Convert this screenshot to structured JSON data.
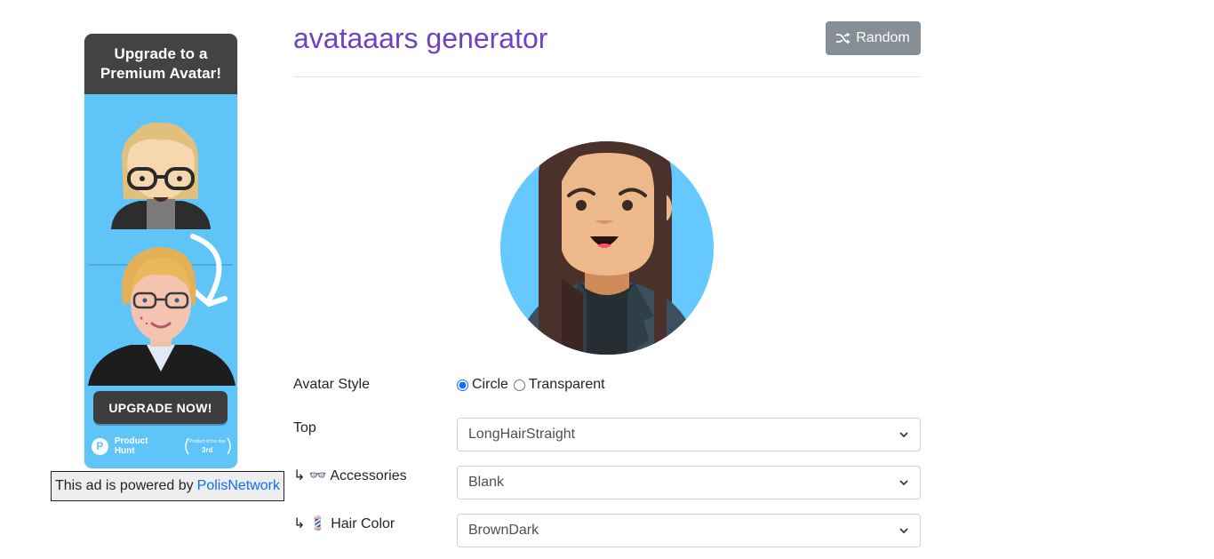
{
  "ad": {
    "headline": "Upgrade to a Premium Avatar!",
    "cta": "UPGRADE NOW!",
    "product_hunt": "Product Hunt",
    "ph_badge_top": "Product of the day",
    "ph_badge_rank": "3rd",
    "powered_prefix": "This ad is powered by",
    "powered_link": "PolisNetwork"
  },
  "header": {
    "title": "avataaars generator",
    "random_label": "Random"
  },
  "form": {
    "style_label": "Avatar Style",
    "style_options": [
      "Circle",
      "Transparent"
    ],
    "style_selected": "Circle",
    "top": {
      "label": "Top",
      "value": "LongHairStraight"
    },
    "accessories": {
      "label": "↳ 👓 Accessories",
      "value": "Blank"
    },
    "hair_color": {
      "label": "↳ 💈 Hair Color",
      "value": "BrownDark"
    }
  },
  "colors": {
    "title": "#6f42c1",
    "random_button": "#868e96",
    "avatar_bg": "#65c9ff",
    "hair": "#4a312c",
    "skin": "#edb98a",
    "ad_bg": "#5fc4f8",
    "link": "#0d6efd"
  }
}
